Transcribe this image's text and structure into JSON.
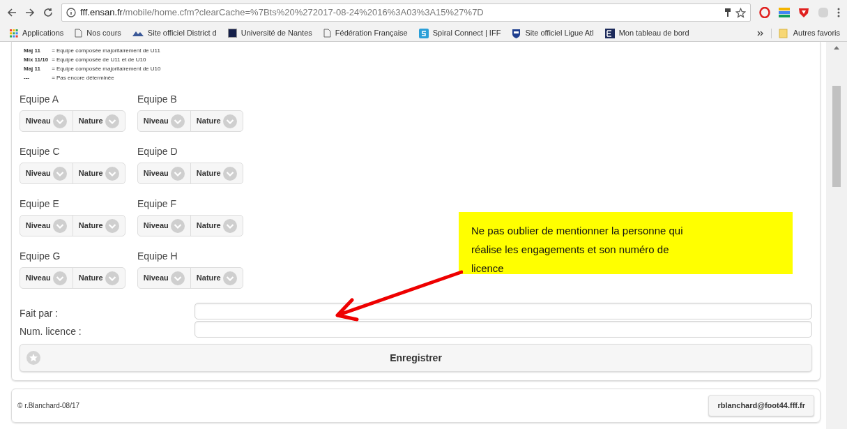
{
  "browser": {
    "url_host": "fff.ensan.fr",
    "url_path": "/mobile/home.cfm?clearCache=%7Bts%20%272017-08-24%2016%3A03%3A15%27%7D",
    "bookmarks": [
      {
        "label": "Applications",
        "kind": "apps"
      },
      {
        "label": "Nos cours",
        "kind": "page"
      },
      {
        "label": "Site officiel District d",
        "kind": "district"
      },
      {
        "label": "Université de Nantes",
        "kind": "univ"
      },
      {
        "label": "Fédération Française",
        "kind": "page"
      },
      {
        "label": "Spiral Connect | IFF",
        "kind": "spiral"
      },
      {
        "label": "Site officiel Ligue Atl",
        "kind": "shield"
      },
      {
        "label": "Mon tableau de bord",
        "kind": "board"
      }
    ],
    "other_bookmarks": "Autres favoris"
  },
  "legend": [
    {
      "code": "Maj 11",
      "meaning": "= Equipe composée majoritairement de U11"
    },
    {
      "code": "Mix 11/10",
      "meaning": "= Equipe composée de U11 et de U10"
    },
    {
      "code": "Maj 11",
      "meaning": "= Equipe composée majoritairement de U10"
    },
    {
      "code": "---",
      "meaning": "= Pas encore déterminée"
    }
  ],
  "teams": [
    {
      "name": "Equipe A",
      "selects": [
        "Niveau",
        "Nature"
      ]
    },
    {
      "name": "Equipe B",
      "selects": [
        "Niveau",
        "Nature"
      ]
    },
    {
      "name": "Equipe C",
      "selects": [
        "Niveau",
        "Nature"
      ]
    },
    {
      "name": "Equipe D",
      "selects": [
        "Niveau",
        "Nature"
      ]
    },
    {
      "name": "Equipe E",
      "selects": [
        "Niveau",
        "Nature"
      ]
    },
    {
      "name": "Equipe F",
      "selects": [
        "Niveau",
        "Nature"
      ]
    },
    {
      "name": "Equipe G",
      "selects": [
        "Niveau",
        "Nature"
      ]
    },
    {
      "name": "Equipe H",
      "selects": [
        "Niveau",
        "Nature"
      ]
    }
  ],
  "fields": [
    {
      "label": "Fait par :"
    },
    {
      "label": "Num. licence :"
    }
  ],
  "save_button": "Enregistrer",
  "callout": "Ne pas oublier de mentionner la personne qui réalise les engagements et son numéro de licence",
  "footer": {
    "copyright": "© r.Blanchard-08/17",
    "email_button": "rblanchard@foot44.fff.fr"
  }
}
